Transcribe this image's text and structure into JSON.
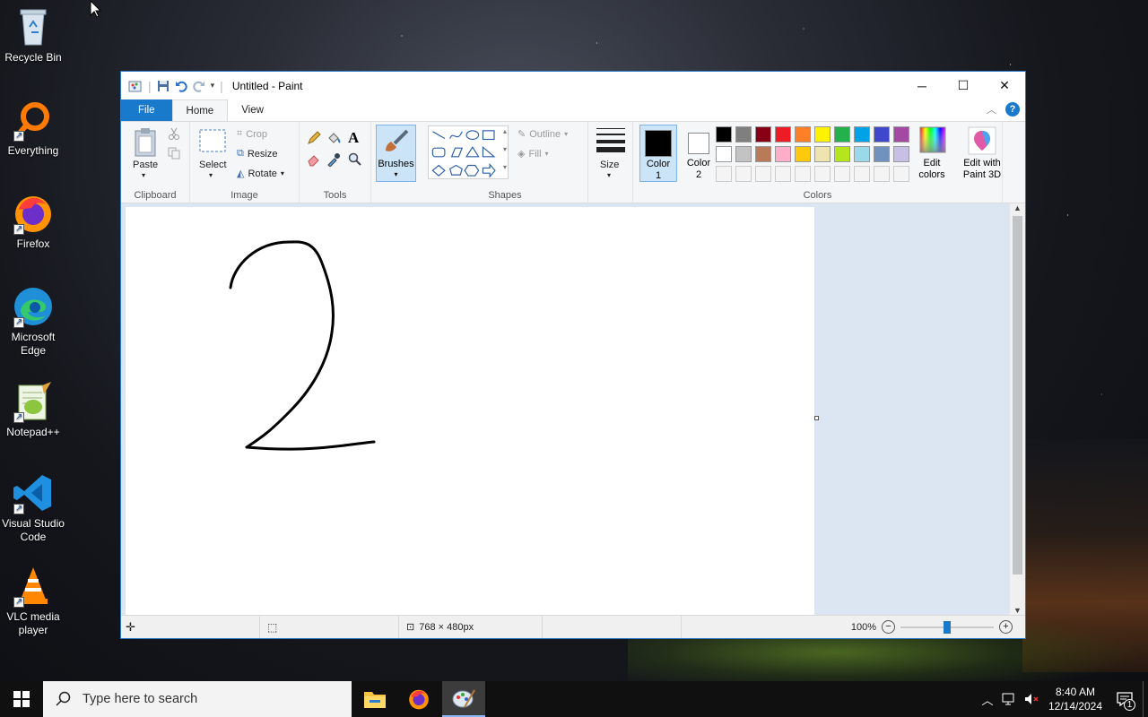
{
  "desktop": {
    "icons": [
      {
        "label": "Recycle Bin",
        "icon": "recycle-bin-icon"
      },
      {
        "label": "Everything",
        "icon": "everything-search-icon"
      },
      {
        "label": "Firefox",
        "icon": "firefox-icon"
      },
      {
        "label": "Microsoft Edge",
        "icon": "edge-icon"
      },
      {
        "label": "Notepad++",
        "icon": "notepadpp-icon"
      },
      {
        "label": "Visual Studio Code",
        "icon": "vscode-icon"
      },
      {
        "label": "VLC media player",
        "icon": "vlc-icon"
      }
    ]
  },
  "window": {
    "title": "Untitled - Paint",
    "tabs": {
      "file": "File",
      "home": "Home",
      "view": "View"
    },
    "help": "?"
  },
  "ribbon": {
    "clipboard": {
      "label": "Clipboard",
      "paste": "Paste"
    },
    "image": {
      "label": "Image",
      "select": "Select",
      "crop": "Crop",
      "resize": "Resize",
      "rotate": "Rotate"
    },
    "tools": {
      "label": "Tools",
      "text_glyph": "A"
    },
    "brushes": {
      "label": "Brushes"
    },
    "shapes": {
      "label": "Shapes",
      "outline": "Outline",
      "fill": "Fill"
    },
    "size": {
      "label": "Size"
    },
    "colors": {
      "label": "Colors",
      "color1": "Color\n1",
      "color1_line1": "Color",
      "color1_line2": "1",
      "color2_line1": "Color",
      "color2_line2": "2",
      "edit_colors_line1": "Edit",
      "edit_colors_line2": "colors",
      "color1_value": "#000000",
      "color2_value": "#ffffff",
      "palette_row1": [
        "#000000",
        "#7f7f7f",
        "#880015",
        "#ed1c24",
        "#ff7f27",
        "#fff200",
        "#22b14c",
        "#00a2e8",
        "#3f48cc",
        "#a349a4"
      ],
      "palette_row2": [
        "#ffffff",
        "#c3c3c3",
        "#b97a57",
        "#ffaec9",
        "#ffc90e",
        "#efe4b0",
        "#b5e61d",
        "#99d9ea",
        "#7092be",
        "#c8bfe7"
      ]
    },
    "paint3d": {
      "line1": "Edit with",
      "line2": "Paint 3D"
    }
  },
  "status": {
    "dimensions": "768 × 480px",
    "zoom": "100%",
    "zoom_level": 0.5
  },
  "taskbar": {
    "search_placeholder": "Type here to search",
    "time": "8:40 AM",
    "date": "12/14/2024",
    "notifications": "1"
  }
}
